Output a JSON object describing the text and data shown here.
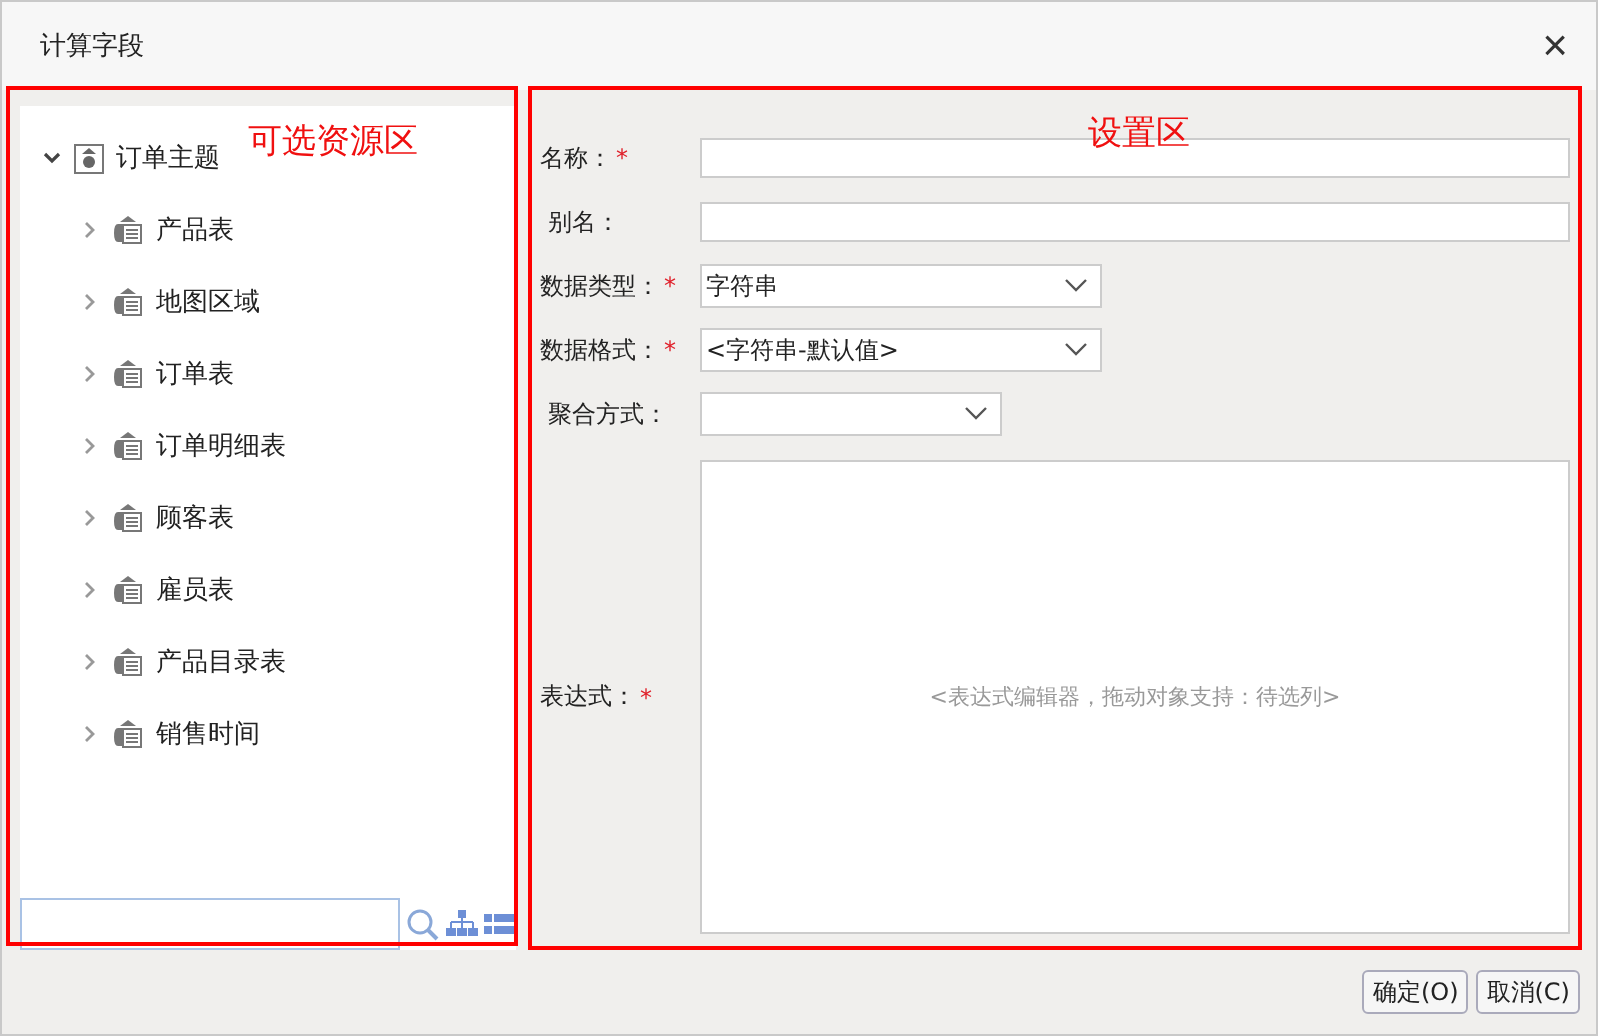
{
  "window": {
    "title": "计算字段",
    "close": "×"
  },
  "tree": {
    "label": "订单主题",
    "expanded": true,
    "children": [
      {
        "label": "产品表",
        "expanded": false
      },
      {
        "label": "地图区域",
        "expanded": false
      },
      {
        "label": "订单表",
        "expanded": false
      },
      {
        "label": "订单明细表",
        "expanded": false
      },
      {
        "label": "顾客表",
        "expanded": false
      },
      {
        "label": "雇员表",
        "expanded": false
      },
      {
        "label": "产品目录表",
        "expanded": false
      },
      {
        "label": "销售时间",
        "expanded": false
      }
    ]
  },
  "form": [
    {
      "kind": "text",
      "label": "名称：",
      "required": true
    },
    {
      "kind": "text",
      "label": "别名：",
      "required": false
    },
    {
      "kind": "select",
      "label": "数据类型：",
      "required": true,
      "value": "字符串"
    },
    {
      "kind": "select",
      "label": "数据格式：",
      "required": true,
      "value": "<字符串-默认值>"
    },
    {
      "kind": "select",
      "label": "聚合方式：",
      "required": false
    },
    {
      "kind": "textarea",
      "label": "表达式：",
      "required": true,
      "placeholder": "<表达式编辑器，拖动对象支持：待选列>"
    }
  ],
  "buttons": [
    "确定(O)",
    "取消(C)"
  ],
  "required_mark": "*",
  "annotations": [
    {
      "kind": "left",
      "label": "可选资源区"
    },
    {
      "kind": "right",
      "label": "设置区"
    }
  ]
}
